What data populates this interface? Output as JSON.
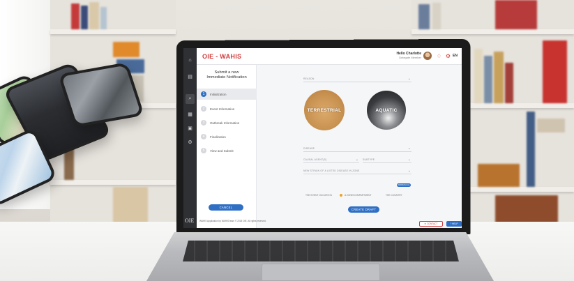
{
  "app": {
    "brand": "OIE - WAHIS",
    "user_name": "Hello Charlotte",
    "user_role": "Delegate Member",
    "language": "EN",
    "rail_logo": "OIE"
  },
  "left_panel": {
    "title_line1": "Submit a new",
    "title_line2": "Immediate Notification",
    "steps": [
      {
        "num": "1",
        "label": "Initialization"
      },
      {
        "num": "2",
        "label": "Event Information"
      },
      {
        "num": "3",
        "label": "Outbreak Information"
      },
      {
        "num": "4",
        "label": "Finalization"
      },
      {
        "num": "5",
        "label": "View and Submit"
      }
    ],
    "cancel_label": "CANCEL",
    "footer_note": "WAHIS Application by WAHIS team © 2018 OIE. All rights reserved."
  },
  "main": {
    "fields": {
      "reason": "REASON",
      "disease": "DISEASE",
      "causal_agent": "CAUSAL AGENT(S)",
      "subtype": "SUBTYPE",
      "new_strain": "NEW STRAIN OF A LISTED DISEASE IN ZONE"
    },
    "circles": {
      "terrestrial": "TERRESTRIAL",
      "aquatic": "AQUATIC"
    },
    "small_button": "REFRESH ALL",
    "event_occurs_label": "THE EVENT OCCURS IN",
    "radio_options": [
      "A ZONE/COMPARTMENT",
      "THE COUNTRY"
    ],
    "create_label": "CREATE DRAFT",
    "contact_label": "CONTACT",
    "help_label": "HELP"
  },
  "colors": {
    "brand_red": "#d33c3c",
    "primary_blue": "#2f6fc4",
    "accent_orange": "#f0a21f"
  }
}
